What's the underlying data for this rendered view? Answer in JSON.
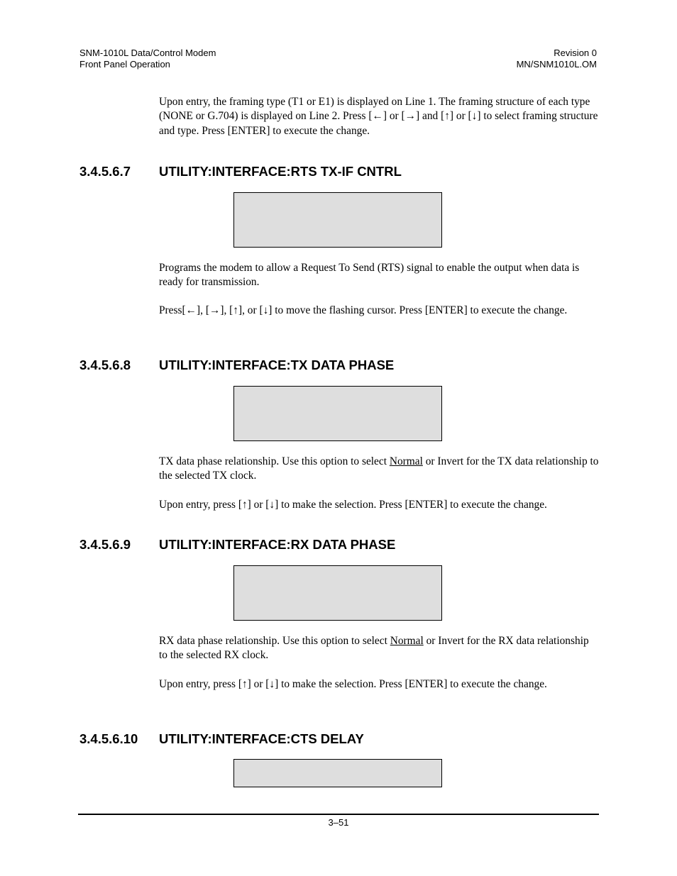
{
  "header": {
    "left_line1": "SNM-1010L Data/Control Modem",
    "left_line2": "Front Panel Operation",
    "right_line1": "Revision 0",
    "right_line2": "MN/SNM1010L.OM"
  },
  "intro": {
    "paragraph": "Upon entry, the framing type (T1 or E1) is displayed on Line 1. The framing structure of each type (NONE or G.704) is displayed on Line 2. Press [←] or [→] and [↑] or [↓] to select framing structure and type. Press [ENTER] to execute the change."
  },
  "sections": [
    {
      "number": "3.4.5.6.7",
      "title": "UTILITY:INTERFACE:RTS TX-IF CNTRL",
      "display": {
        "line1": "",
        "line2": ""
      },
      "paragraph1": "Programs the modem to allow a Request To Send (RTS) signal to enable the output when data is ready for transmission.",
      "paragraph2": "Press[←], [→], [↑], or [↓] to move the flashing cursor. Press [ENTER] to execute the change."
    },
    {
      "number": "3.4.5.6.8",
      "title": "UTILITY:INTERFACE:TX DATA PHASE",
      "display": {
        "line1": "",
        "line2": ""
      },
      "paragraph1_pre": "TX data phase relationship. Use this option to select ",
      "paragraph1_underlined": "Normal",
      "paragraph1_post": " or Invert for the TX data relationship to the selected TX clock.",
      "paragraph2": "Upon entry, press [↑] or [↓] to make the selection. Press [ENTER] to execute the change."
    },
    {
      "number": "3.4.5.6.9",
      "title": "UTILITY:INTERFACE:RX DATA PHASE",
      "display": {
        "line1": "",
        "line2": ""
      },
      "paragraph1_pre": "RX data phase relationship. Use this option to select ",
      "paragraph1_underlined": "Normal",
      "paragraph1_post": " or Invert for the RX data relationship to the selected RX clock.",
      "paragraph2": "Upon entry, press [↑] or [↓] to make the selection. Press [ENTER] to execute the change."
    },
    {
      "number": "3.4.5.6.10",
      "title": "UTILITY:INTERFACE:CTS DELAY",
      "display": {
        "line1": ""
      }
    }
  ],
  "footer": {
    "page_number": "3–51"
  },
  "colors": {
    "display_box_fill": "#dedede",
    "text": "#000000"
  }
}
